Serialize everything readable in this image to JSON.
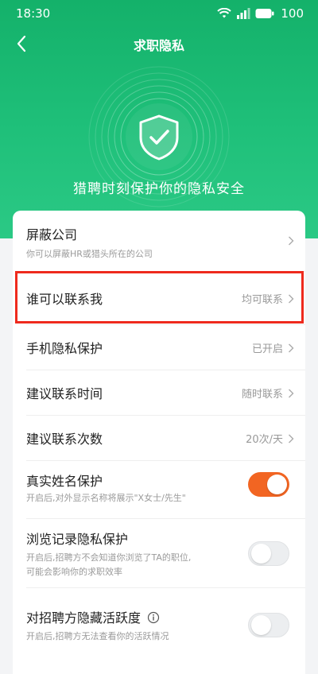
{
  "status_bar": {
    "time": "18:30",
    "battery": "100"
  },
  "nav": {
    "title": "求职隐私"
  },
  "hero": {
    "caption": "猎聘时刻保护你的隐私安全"
  },
  "settings": [
    {
      "title": "屏蔽公司",
      "subtitle": "你可以屏蔽HR或猎头所在的公司",
      "value": ""
    },
    {
      "title": "谁可以联系我",
      "value": "均可联系"
    },
    {
      "title": "手机隐私保护",
      "value": "已开启"
    },
    {
      "title": "建议联系时间",
      "value": "随时联系"
    },
    {
      "title": "建议联系次数",
      "value": "20次/天"
    },
    {
      "title": "真实姓名保护",
      "subtitle": "开启后,对外显示名称将展示\"X女士/先生\"",
      "enabled": true
    },
    {
      "title": "浏览记录隐私保护",
      "subtitle_line1": "开启后,招聘方不会知道你浏览了TA的职位,",
      "subtitle_line2": "可能会影响你的求职效率",
      "enabled": false
    },
    {
      "title": "对招聘方隐藏活跃度",
      "subtitle": "开启后,招聘方无法查看你的活跃情况",
      "enabled": false
    }
  ],
  "colors": {
    "brand_green": "#1fc07a",
    "toggle_on": "#f26522",
    "highlight": "#ee2a1d"
  }
}
